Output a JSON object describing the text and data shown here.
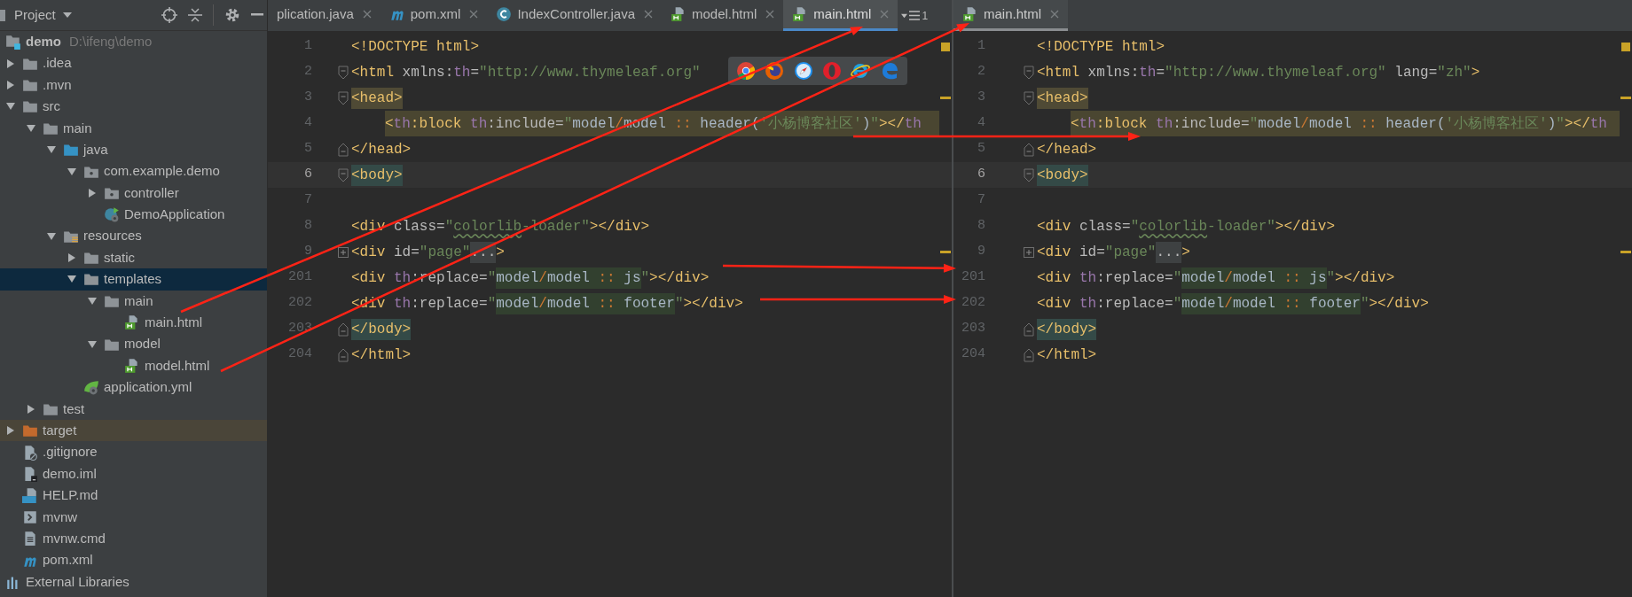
{
  "sidebar": {
    "title": "Project",
    "tree": [
      {
        "label": "demo",
        "path": "D:\\ifeng\\demo",
        "kind": "module",
        "selected": false,
        "children": [
          {
            "label": ".idea",
            "kind": "folder",
            "expanded": false,
            "selected": false
          },
          {
            "label": ".mvn",
            "kind": "folder",
            "expanded": false,
            "selected": false
          },
          {
            "label": "src",
            "kind": "folder",
            "expanded": true,
            "selected": false,
            "children": [
              {
                "label": "main",
                "kind": "folder",
                "expanded": true,
                "selected": false,
                "children": [
                  {
                    "label": "java",
                    "kind": "source-folder",
                    "expanded": true,
                    "selected": false,
                    "children": [
                      {
                        "label": "com.example.demo",
                        "kind": "package",
                        "expanded": true,
                        "selected": false,
                        "children": [
                          {
                            "label": "controller",
                            "kind": "package",
                            "expanded": false,
                            "selected": false
                          },
                          {
                            "label": "DemoApplication",
                            "kind": "spring-class",
                            "selected": false
                          }
                        ]
                      }
                    ]
                  },
                  {
                    "label": "resources",
                    "kind": "resources-folder",
                    "expanded": true,
                    "selected": false,
                    "children": [
                      {
                        "label": "static",
                        "kind": "folder",
                        "expanded": false,
                        "selected": false
                      },
                      {
                        "label": "templates",
                        "kind": "folder",
                        "expanded": true,
                        "selected": true,
                        "children": [
                          {
                            "label": "main",
                            "kind": "folder",
                            "expanded": true,
                            "selected": false,
                            "children": [
                              {
                                "label": "main.html",
                                "kind": "html",
                                "selected": false
                              }
                            ]
                          },
                          {
                            "label": "model",
                            "kind": "folder",
                            "expanded": true,
                            "selected": false,
                            "children": [
                              {
                                "label": "model.html",
                                "kind": "html",
                                "selected": false
                              }
                            ]
                          }
                        ]
                      },
                      {
                        "label": "application.yml",
                        "kind": "yml",
                        "selected": false
                      }
                    ]
                  }
                ]
              },
              {
                "label": "test",
                "kind": "folder",
                "expanded": false,
                "selected": false
              }
            ]
          },
          {
            "label": "target",
            "kind": "excluded-folder",
            "expanded": false,
            "selected": false
          },
          {
            "label": ".gitignore",
            "kind": "gitignore",
            "selected": false
          },
          {
            "label": "demo.iml",
            "kind": "iml",
            "selected": false
          },
          {
            "label": "HELP.md",
            "kind": "markdown",
            "selected": false
          },
          {
            "label": "mvnw",
            "kind": "shell",
            "selected": false
          },
          {
            "label": "mvnw.cmd",
            "kind": "text-file",
            "selected": false
          },
          {
            "label": "pom.xml",
            "kind": "maven",
            "selected": false
          }
        ]
      },
      {
        "label": "External Libraries",
        "kind": "library",
        "selected": false
      }
    ]
  },
  "editors": [
    {
      "focused": true,
      "tabs": [
        {
          "label": "plication.java",
          "kind": "none",
          "selected": false
        },
        {
          "label": "pom.xml",
          "kind": "maven",
          "selected": false
        },
        {
          "label": "IndexController.java",
          "kind": "class",
          "selected": false
        },
        {
          "label": "model.html",
          "kind": "html",
          "selected": false
        },
        {
          "label": "main.html",
          "kind": "html",
          "selected": true
        }
      ],
      "overflow_count": "1",
      "browsers": [
        {
          "kind": "chrome"
        },
        {
          "kind": "firefox"
        },
        {
          "kind": "safari"
        },
        {
          "kind": "opera"
        },
        {
          "kind": "ie"
        },
        {
          "kind": "edge"
        }
      ],
      "lines": [
        {
          "number": "1",
          "current": false,
          "kind": "plain",
          "segments": [
            {
              "text": "<!DOCTYPE html>",
              "kind": "tag"
            }
          ]
        },
        {
          "number": "2",
          "current": false,
          "kind": "fold-start",
          "segments": [
            {
              "text": "<html",
              "kind": "tag"
            },
            {
              "text": " xmlns:",
              "kind": "attr"
            },
            {
              "text": "th",
              "kind": "ns"
            },
            {
              "text": "=",
              "kind": "attr"
            },
            {
              "text": "\"http://www.thymeleaf.org\"",
              "kind": "str"
            }
          ]
        },
        {
          "number": "3",
          "current": false,
          "warning": true,
          "kind": "fold-start",
          "segments": [
            {
              "text": "<head>",
              "kind": "tag-match"
            }
          ]
        },
        {
          "number": "4",
          "current": false,
          "kind": "highlight",
          "segments": [
            {
              "text": "<",
              "kind": "tag"
            },
            {
              "text": "th",
              "kind": "ns"
            },
            {
              "text": ":block ",
              "kind": "tag"
            },
            {
              "text": "th",
              "kind": "ns"
            },
            {
              "text": ":include=",
              "kind": "attr"
            },
            {
              "text": "\"",
              "kind": "str"
            },
            {
              "text": "model",
              "kind": "expr"
            },
            {
              "text": "/",
              "kind": "op"
            },
            {
              "text": "model ",
              "kind": "expr"
            },
            {
              "text": "::",
              "kind": "op"
            },
            {
              "text": " header(",
              "kind": "expr"
            },
            {
              "text": "'小杨博客社区'",
              "kind": "str"
            },
            {
              "text": ")",
              "kind": "expr"
            },
            {
              "text": "\"",
              "kind": "str"
            },
            {
              "text": "></",
              "kind": "tag"
            },
            {
              "text": "th",
              "kind": "ns"
            }
          ]
        },
        {
          "number": "5",
          "current": false,
          "kind": "fold-end",
          "segments": [
            {
              "text": "</head>",
              "kind": "tag"
            }
          ]
        },
        {
          "number": "6",
          "current": true,
          "kind": "fold-start",
          "segments": [
            {
              "text": "<body>",
              "kind": "tag-body"
            }
          ]
        },
        {
          "number": "7",
          "current": false,
          "kind": "plain"
        },
        {
          "number": "8",
          "current": false,
          "kind": "plain",
          "segments": [
            {
              "text": "<div",
              "kind": "tag"
            },
            {
              "text": " class=",
              "kind": "attr"
            },
            {
              "text": "\"",
              "kind": "str"
            },
            {
              "text": "colorlib",
              "kind": "str-typo"
            },
            {
              "text": "-loader\"",
              "kind": "str"
            },
            {
              "text": "></div>",
              "kind": "tag"
            }
          ]
        },
        {
          "number": "9",
          "current": false,
          "warning": true,
          "kind": "folded",
          "segments": [
            {
              "text": "<div",
              "kind": "tag"
            },
            {
              "text": " id=",
              "kind": "attr"
            },
            {
              "text": "\"page\"",
              "kind": "str"
            },
            {
              "text": "...",
              "kind": "folded-text"
            },
            {
              "text": ">",
              "kind": "tag"
            }
          ]
        },
        {
          "number": "201",
          "current": false,
          "kind": "plain",
          "segments": [
            {
              "text": "<div ",
              "kind": "tag"
            },
            {
              "text": "th",
              "kind": "ns"
            },
            {
              "text": ":replace=",
              "kind": "attr"
            },
            {
              "text": "\"",
              "kind": "str"
            },
            {
              "text": "model",
              "kind": "expr-ref"
            },
            {
              "text": "/",
              "kind": "op-ref"
            },
            {
              "text": "model ",
              "kind": "expr-ref"
            },
            {
              "text": "::",
              "kind": "op-ref"
            },
            {
              "text": " js",
              "kind": "expr-ref"
            },
            {
              "text": "\"",
              "kind": "str"
            },
            {
              "text": "></div>",
              "kind": "tag"
            }
          ]
        },
        {
          "number": "202",
          "current": false,
          "kind": "plain",
          "segments": [
            {
              "text": "<div ",
              "kind": "tag"
            },
            {
              "text": "th",
              "kind": "ns"
            },
            {
              "text": ":replace=",
              "kind": "attr"
            },
            {
              "text": "\"",
              "kind": "str"
            },
            {
              "text": "model",
              "kind": "expr-ref"
            },
            {
              "text": "/",
              "kind": "op-ref"
            },
            {
              "text": "model ",
              "kind": "expr-ref"
            },
            {
              "text": "::",
              "kind": "op-ref"
            },
            {
              "text": " footer",
              "kind": "expr-ref"
            },
            {
              "text": "\"",
              "kind": "str"
            },
            {
              "text": "></div>",
              "kind": "tag"
            }
          ]
        },
        {
          "number": "203",
          "current": false,
          "kind": "fold-end",
          "segments": [
            {
              "text": "</body>",
              "kind": "tag-body"
            }
          ]
        },
        {
          "number": "204",
          "current": false,
          "kind": "fold-end",
          "segments": [
            {
              "text": "</html>",
              "kind": "tag"
            }
          ]
        }
      ]
    },
    {
      "focused": false,
      "tabs": [
        {
          "label": "main.html",
          "kind": "html",
          "selected": true
        }
      ],
      "lines": [
        {
          "number": "1",
          "current": false,
          "kind": "plain",
          "segments": [
            {
              "text": "<!DOCTYPE html>",
              "kind": "tag"
            }
          ]
        },
        {
          "number": "2",
          "current": false,
          "kind": "fold-start",
          "segments": [
            {
              "text": "<html",
              "kind": "tag"
            },
            {
              "text": " xmlns:",
              "kind": "attr"
            },
            {
              "text": "th",
              "kind": "ns"
            },
            {
              "text": "=",
              "kind": "attr"
            },
            {
              "text": "\"http://www.thymeleaf.org\"",
              "kind": "str"
            },
            {
              "text": " lang=",
              "kind": "attr"
            },
            {
              "text": "\"zh\"",
              "kind": "str"
            },
            {
              "text": ">",
              "kind": "tag"
            }
          ]
        },
        {
          "number": "3",
          "current": false,
          "warning": true,
          "kind": "fold-start",
          "segments": [
            {
              "text": "<head>",
              "kind": "tag-match"
            }
          ]
        },
        {
          "number": "4",
          "current": false,
          "kind": "highlight",
          "segments": [
            {
              "text": "<",
              "kind": "tag"
            },
            {
              "text": "th",
              "kind": "ns"
            },
            {
              "text": ":block ",
              "kind": "tag"
            },
            {
              "text": "th",
              "kind": "ns"
            },
            {
              "text": ":include=",
              "kind": "attr"
            },
            {
              "text": "\"",
              "kind": "str"
            },
            {
              "text": "model",
              "kind": "expr"
            },
            {
              "text": "/",
              "kind": "op"
            },
            {
              "text": "model ",
              "kind": "expr"
            },
            {
              "text": "::",
              "kind": "op"
            },
            {
              "text": " header(",
              "kind": "expr"
            },
            {
              "text": "'小杨博客社区'",
              "kind": "str"
            },
            {
              "text": ")",
              "kind": "expr"
            },
            {
              "text": "\"",
              "kind": "str"
            },
            {
              "text": "></",
              "kind": "tag"
            },
            {
              "text": "th",
              "kind": "ns"
            }
          ]
        },
        {
          "number": "5",
          "current": false,
          "kind": "fold-end",
          "segments": [
            {
              "text": "</head>",
              "kind": "tag"
            }
          ]
        },
        {
          "number": "6",
          "current": true,
          "kind": "fold-start",
          "segments": [
            {
              "text": "<body>",
              "kind": "tag-body"
            }
          ]
        },
        {
          "number": "7",
          "current": false,
          "kind": "plain"
        },
        {
          "number": "8",
          "current": false,
          "kind": "plain",
          "segments": [
            {
              "text": "<div",
              "kind": "tag"
            },
            {
              "text": " class=",
              "kind": "attr"
            },
            {
              "text": "\"",
              "kind": "str"
            },
            {
              "text": "colorlib",
              "kind": "str-typo"
            },
            {
              "text": "-loader\"",
              "kind": "str"
            },
            {
              "text": "></div>",
              "kind": "tag"
            }
          ]
        },
        {
          "number": "9",
          "current": false,
          "warning": true,
          "kind": "folded",
          "segments": [
            {
              "text": "<div",
              "kind": "tag"
            },
            {
              "text": " id=",
              "kind": "attr"
            },
            {
              "text": "\"page\"",
              "kind": "str"
            },
            {
              "text": "...",
              "kind": "folded-text"
            },
            {
              "text": ">",
              "kind": "tag"
            }
          ]
        },
        {
          "number": "201",
          "current": false,
          "kind": "plain",
          "segments": [
            {
              "text": "<div ",
              "kind": "tag"
            },
            {
              "text": "th",
              "kind": "ns"
            },
            {
              "text": ":replace=",
              "kind": "attr"
            },
            {
              "text": "\"",
              "kind": "str"
            },
            {
              "text": "model",
              "kind": "expr-ref"
            },
            {
              "text": "/",
              "kind": "op-ref"
            },
            {
              "text": "model ",
              "kind": "expr-ref"
            },
            {
              "text": "::",
              "kind": "op-ref"
            },
            {
              "text": " js",
              "kind": "expr-ref"
            },
            {
              "text": "\"",
              "kind": "str"
            },
            {
              "text": "></div>",
              "kind": "tag"
            }
          ]
        },
        {
          "number": "202",
          "current": false,
          "kind": "plain",
          "segments": [
            {
              "text": "<div ",
              "kind": "tag"
            },
            {
              "text": "th",
              "kind": "ns"
            },
            {
              "text": ":replace=",
              "kind": "attr"
            },
            {
              "text": "\"",
              "kind": "str"
            },
            {
              "text": "model",
              "kind": "expr-ref"
            },
            {
              "text": "/",
              "kind": "op-ref"
            },
            {
              "text": "model ",
              "kind": "expr-ref"
            },
            {
              "text": "::",
              "kind": "op-ref"
            },
            {
              "text": " footer",
              "kind": "expr-ref"
            },
            {
              "text": "\"",
              "kind": "str"
            },
            {
              "text": "></div>",
              "kind": "tag"
            }
          ]
        },
        {
          "number": "203",
          "current": false,
          "kind": "fold-end",
          "segments": [
            {
              "text": "</body>",
              "kind": "tag-body"
            }
          ]
        },
        {
          "number": "204",
          "current": false,
          "kind": "fold-end",
          "segments": [
            {
              "text": "</html>",
              "kind": "tag"
            }
          ]
        }
      ]
    }
  ]
}
